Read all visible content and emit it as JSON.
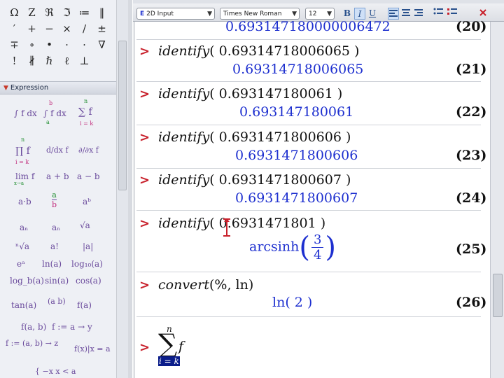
{
  "palette": {
    "symbol_rows": [
      [
        "Ω",
        "Ζ",
        "ℜ",
        "ℑ",
        "≔",
        "‖"
      ],
      [
        "′",
        "+",
        "−",
        "×",
        "/",
        "±"
      ],
      [
        "∓",
        "∘",
        "•",
        "·",
        "·",
        "∇"
      ],
      [
        "!",
        "∦",
        "ℏ",
        "ℓ",
        "⊥",
        ""
      ]
    ],
    "expression_header": "Expression",
    "expressions": {
      "int_fdx": "∫ f dx",
      "defint": "∫ f dx",
      "defint_a": "a",
      "defint_b": "b",
      "sum_f": "∑ f",
      "sum_top": "n",
      "sum_bot": "i = k",
      "prod_f": "∏ f",
      "prod_top": "n",
      "prod_bot": "i = k",
      "deriv": "d/dx f",
      "partial": "∂/∂x f",
      "lim": "lim f",
      "lim_sub": "x→a",
      "a_plus_b": "a + b",
      "a_minus_b": "a − b",
      "a_dot_b": "a·b",
      "a_over_b_num": "a",
      "a_over_b_den": "b",
      "a_pow_b": "aᵇ",
      "a_sub_n": "aₙ",
      "a_sub_n2": "aₙ",
      "sqrt_a": "√a",
      "nroot_a": "ⁿ√a",
      "a_fact": "a!",
      "abs_a": "|a|",
      "exp_a": "eᵃ",
      "ln_a": "ln(a)",
      "log10_a": "log₁₀(a)",
      "logb_a": "log_b(a)",
      "sin_a": "sin(a)",
      "cos_a": "cos(a)",
      "tan_a": "tan(a)",
      "binom": "(a b)",
      "f_a": "f(a)",
      "f_ab": "f(a, b)",
      "f_arrow": "f := a → y",
      "f_map": "f := (a, b) → z",
      "f_eval": "f(x)|x = a",
      "piecewise": "{ −x  x < a"
    }
  },
  "toolbar": {
    "mode": "2D Input",
    "font": "Times New Roman",
    "size": "12",
    "bold": "B",
    "italic": "I",
    "underline": "U"
  },
  "worksheet": {
    "partial_output": "0.693147180000006472",
    "partial_label": "(20)",
    "entries": [
      {
        "fn": "identify",
        "arg": "( 0.69314718006065 )",
        "output": "0.69314718006065",
        "label": "(21)"
      },
      {
        "fn": "identify",
        "arg": "( 0.693147180061 )",
        "output": "0.693147180061",
        "label": "(22)"
      },
      {
        "fn": "identify",
        "arg": "( 0.6931471800606 )",
        "output": "0.6931471800606",
        "label": "(23)"
      },
      {
        "fn": "identify",
        "arg": "( 0.6931471800607 )",
        "output": "0.6931471800607",
        "label": "(24)"
      },
      {
        "fn": "identify",
        "arg": "( 0.6931471801 )",
        "output_fn": "arcsinh",
        "output_num": "3",
        "output_den": "4",
        "label": "(25)"
      },
      {
        "fn": "convert",
        "arg": "(%, ln)",
        "output": "ln( 2 )",
        "label": "(26)"
      }
    ],
    "sum_input": {
      "top": "n",
      "body": "f",
      "bottom": "i = k"
    }
  },
  "colors": {
    "prompt": "#c8202b",
    "output": "#1d2fcf"
  }
}
